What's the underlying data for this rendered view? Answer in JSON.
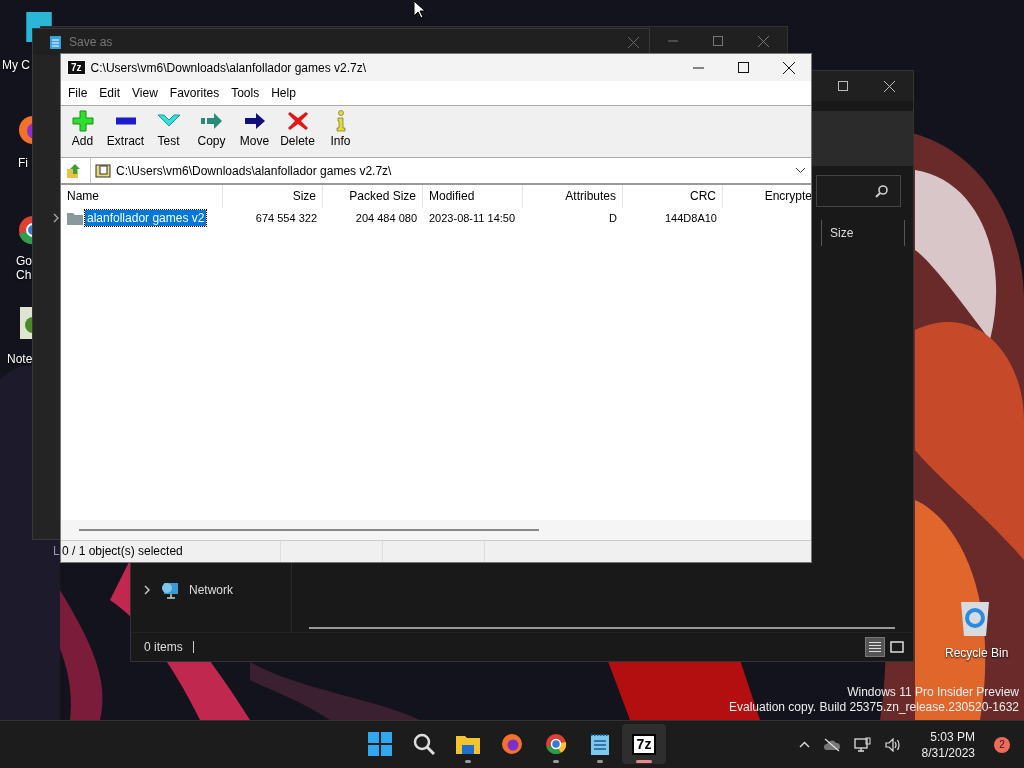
{
  "desktop": {
    "icons": [
      {
        "kind": "computer",
        "label": "My C"
      },
      {
        "kind": "firefox",
        "label": "Fi"
      },
      {
        "kind": "chrome",
        "label": "Go Ch"
      },
      {
        "kind": "notepad",
        "label": "Note"
      },
      {
        "kind": "recycle",
        "label": "Recycle Bin"
      }
    ],
    "watermark": [
      "Windows 11 Pro Insider Preview",
      "Evaluation copy. Build 25375.zn_release.230520-1632"
    ]
  },
  "explorer": {
    "column": "Size",
    "sidebar": [
      {
        "label": "Network",
        "expanded": false
      }
    ],
    "status": "0 items",
    "view_buttons": [
      {
        "kind": "details",
        "selected": true
      },
      {
        "kind": "tiles",
        "selected": false
      }
    ]
  },
  "save_dialog": {
    "title": "Save as",
    "fragment": "L"
  },
  "sevenzip": {
    "icon_text": "7z",
    "title": "C:\\Users\\vm6\\Downloads\\alanfollador games v2.7z\\",
    "menu": [
      "File",
      "Edit",
      "View",
      "Favorites",
      "Tools",
      "Help"
    ],
    "toolbar": [
      {
        "kind": "add",
        "label": "Add"
      },
      {
        "kind": "extract",
        "label": "Extract"
      },
      {
        "kind": "test",
        "label": "Test"
      },
      {
        "kind": "copy",
        "label": "Copy"
      },
      {
        "kind": "move",
        "label": "Move"
      },
      {
        "kind": "delete",
        "label": "Delete"
      },
      {
        "kind": "info",
        "label": "Info"
      }
    ],
    "address": "C:\\Users\\vm6\\Downloads\\alanfollador games v2.7z\\",
    "columns": [
      "Name",
      "Size",
      "Packed Size",
      "Modified",
      "Attributes",
      "CRC",
      "Encrypte"
    ],
    "rows": [
      {
        "selected": true,
        "cells": [
          "alanfollador games v2",
          "674 554 322",
          "204 484 080",
          "2023-08-11 14:50",
          "D",
          "144D8A10"
        ]
      }
    ],
    "status": "0 / 1 object(s) selected"
  },
  "taskbar": {
    "apps": [
      {
        "kind": "start",
        "running": false,
        "active": false
      },
      {
        "kind": "search",
        "running": false,
        "active": false
      },
      {
        "kind": "explorer",
        "running": true,
        "active": false
      },
      {
        "kind": "firefox",
        "running": false,
        "active": false
      },
      {
        "kind": "chrome",
        "running": true,
        "active": false
      },
      {
        "kind": "notepad",
        "running": true,
        "active": false
      },
      {
        "kind": "sevenzip",
        "logo": "7z",
        "running": true,
        "active": true
      }
    ],
    "time": "5:03 PM",
    "date": "8/31/2023",
    "notifications": "2"
  }
}
